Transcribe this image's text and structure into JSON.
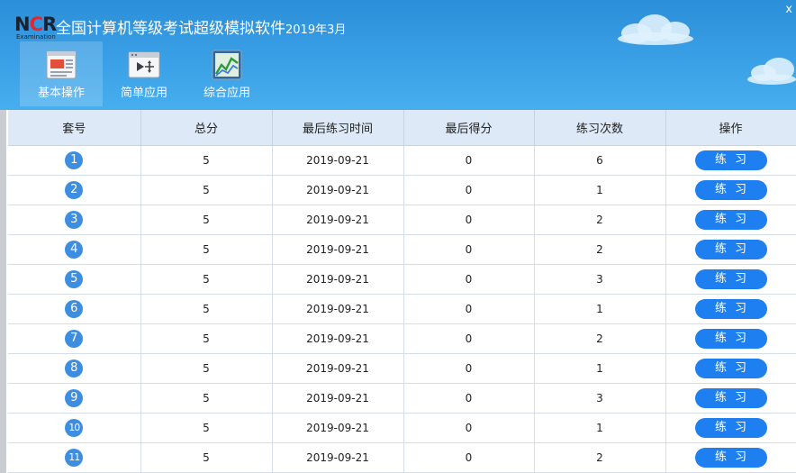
{
  "app": {
    "logo_letters": "NCR",
    "logo_sub": "Examination",
    "title_main": "全国计算机等级考试超级模拟软件",
    "title_date": "2019年3月",
    "close_label": "x"
  },
  "toolbar": {
    "items": [
      {
        "label": "基本操作",
        "icon": "basic-operation-icon",
        "active": true
      },
      {
        "label": "简单应用",
        "icon": "simple-application-icon",
        "active": false
      },
      {
        "label": "综合应用",
        "icon": "comprehensive-application-icon",
        "active": false
      }
    ]
  },
  "table": {
    "columns": [
      "套号",
      "总分",
      "最后练习时间",
      "最后得分",
      "练习次数",
      "操作"
    ],
    "button_label": "练习",
    "rows": [
      {
        "num": "1",
        "total": "5",
        "date": "2019-09-21",
        "score": "0",
        "count": "6"
      },
      {
        "num": "2",
        "total": "5",
        "date": "2019-09-21",
        "score": "0",
        "count": "1"
      },
      {
        "num": "3",
        "total": "5",
        "date": "2019-09-21",
        "score": "0",
        "count": "2"
      },
      {
        "num": "4",
        "total": "5",
        "date": "2019-09-21",
        "score": "0",
        "count": "2"
      },
      {
        "num": "5",
        "total": "5",
        "date": "2019-09-21",
        "score": "0",
        "count": "3"
      },
      {
        "num": "6",
        "total": "5",
        "date": "2019-09-21",
        "score": "0",
        "count": "1"
      },
      {
        "num": "7",
        "total": "5",
        "date": "2019-09-21",
        "score": "0",
        "count": "2"
      },
      {
        "num": "8",
        "total": "5",
        "date": "2019-09-21",
        "score": "0",
        "count": "1"
      },
      {
        "num": "9",
        "total": "5",
        "date": "2019-09-21",
        "score": "0",
        "count": "3"
      },
      {
        "num": "10",
        "total": "5",
        "date": "2019-09-21",
        "score": "0",
        "count": "1"
      },
      {
        "num": "11",
        "total": "5",
        "date": "2019-09-21",
        "score": "0",
        "count": "2"
      }
    ]
  },
  "colors": {
    "header_blue": "#3aa0e6",
    "button_blue": "#1e80f0",
    "circle_blue": "#3d8ee0",
    "table_header_bg": "#dde9f6",
    "logo_red": "#e4262d"
  }
}
